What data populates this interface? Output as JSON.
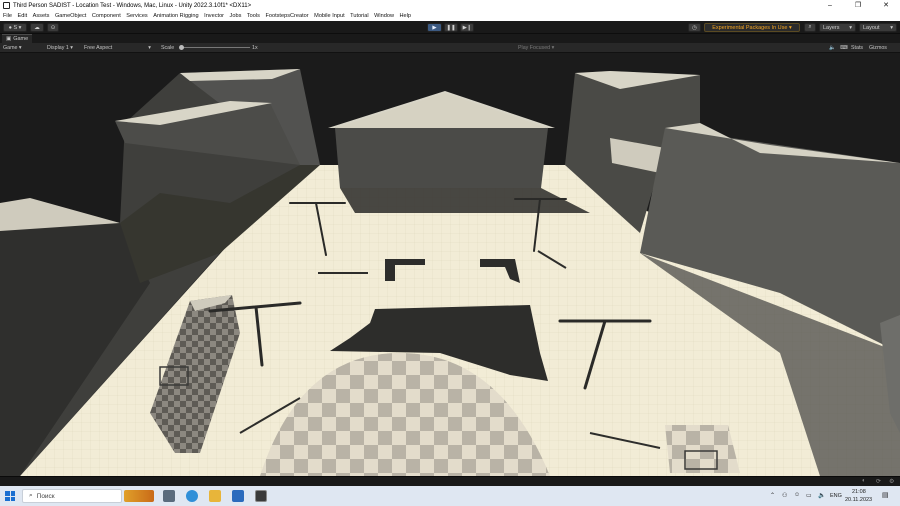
{
  "window": {
    "title": "Third Person SADIST - Location Test - Windows, Mac, Linux - Unity 2022.3.10f1* <DX11>",
    "controls": [
      "–",
      "❐",
      "✕"
    ]
  },
  "menu": [
    "File",
    "Edit",
    "Assets",
    "GameObject",
    "Component",
    "Services",
    "Animation Rigging",
    "Invector",
    "Jobs",
    "Tools",
    "FootstepsCreator",
    "Mobile Input",
    "Tutorial",
    "Window",
    "Help"
  ],
  "toolbar": {
    "account_badge": "S",
    "experimental_label": "Experimental Packages In Use ▾",
    "layers_label": "Layers",
    "layout_label": "Layout"
  },
  "tab": {
    "label": "Game"
  },
  "gamebar": {
    "mode": "Game",
    "display": "Display 1",
    "aspect": "Free Aspect",
    "scale_label": "Scale",
    "scale_value": "1x",
    "play_focused": "Play Focused",
    "stats": "Stats",
    "gizmos": "Gizmos"
  },
  "taskbar": {
    "search_placeholder": "Поиск",
    "language": "ENG",
    "time": "21:08",
    "date": "20.11.2023"
  },
  "colors": {
    "floor": "#f2ecd6",
    "sky": "#1b1b1b",
    "wall": "#4a4a46",
    "roof": "#d5d2c4",
    "accent_orange": "#f5a623",
    "play_blue": "#3c5a82"
  }
}
